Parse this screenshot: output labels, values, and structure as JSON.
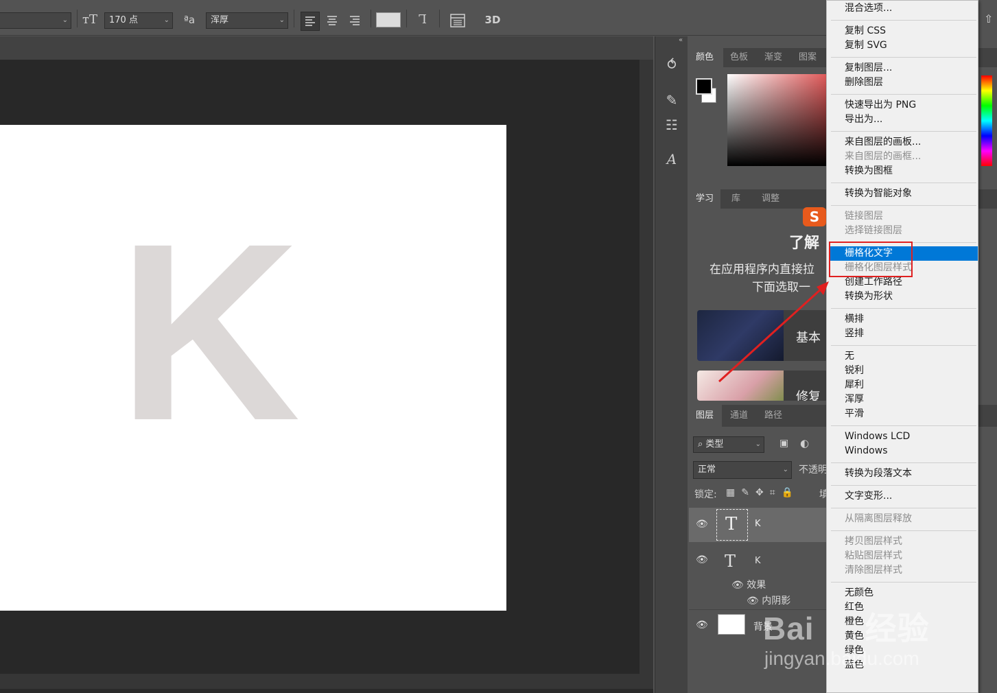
{
  "options_bar": {
    "font_size_value": "170 点",
    "aa_label": "a a",
    "antialias_value": "浑厚",
    "threed_label": "3D"
  },
  "panels": {
    "color_tabs": [
      "颜色",
      "色板",
      "渐变",
      "图案"
    ],
    "learn_tabs": [
      "学习",
      "库",
      "调整"
    ],
    "learn_title": "了解",
    "learn_desc_line1": "在应用程序内直接拉",
    "learn_desc_line2": "下面选取一",
    "learn_cards": [
      "基本",
      "修复"
    ],
    "layers_tabs": [
      "图层",
      "通道",
      "路径"
    ],
    "filter_kind": "类型",
    "blend_mode": "正常",
    "opacity_label": "不透明",
    "lock_label": "锁定:",
    "fill_label": "填"
  },
  "layers": [
    {
      "name": "K",
      "selected": true
    },
    {
      "name": "K",
      "selected": false,
      "effects_label": "效果",
      "effect_name": "内阴影"
    },
    {
      "name": "背景",
      "selected": false
    }
  ],
  "canvas": {
    "letter": "K",
    "letter_color": "#dcd8d7"
  },
  "context_menu": {
    "groups": [
      [
        {
          "label": "混合选项...",
          "disabled": false
        }
      ],
      [
        {
          "label": "复制 CSS",
          "disabled": false
        },
        {
          "label": "复制 SVG",
          "disabled": false
        }
      ],
      [
        {
          "label": "复制图层...",
          "disabled": false
        },
        {
          "label": "删除图层",
          "disabled": false
        }
      ],
      [
        {
          "label": "快速导出为 PNG",
          "disabled": false
        },
        {
          "label": "导出为...",
          "disabled": false
        }
      ],
      [
        {
          "label": "来自图层的画板...",
          "disabled": false
        },
        {
          "label": "来自图层的画框...",
          "disabled": true
        },
        {
          "label": "转换为图框",
          "disabled": false
        }
      ],
      [
        {
          "label": "转换为智能对象",
          "disabled": false
        }
      ],
      [
        {
          "label": "链接图层",
          "disabled": true
        },
        {
          "label": "选择链接图层",
          "disabled": true
        }
      ],
      [
        {
          "label": "栅格化文字",
          "disabled": false,
          "selected": true
        },
        {
          "label": "栅格化图层样式",
          "disabled": true
        },
        {
          "label": "创建工作路径",
          "disabled": false
        },
        {
          "label": "转换为形状",
          "disabled": false
        }
      ],
      [
        {
          "label": "横排",
          "disabled": false
        },
        {
          "label": "竖排",
          "disabled": false
        }
      ],
      [
        {
          "label": "无",
          "disabled": false
        },
        {
          "label": "锐利",
          "disabled": false
        },
        {
          "label": "犀利",
          "disabled": false
        },
        {
          "label": "浑厚",
          "disabled": false
        },
        {
          "label": "平滑",
          "disabled": false
        }
      ],
      [
        {
          "label": "Windows LCD",
          "disabled": false
        },
        {
          "label": "Windows",
          "disabled": false
        }
      ],
      [
        {
          "label": "转换为段落文本",
          "disabled": false
        }
      ],
      [
        {
          "label": "文字变形...",
          "disabled": false
        }
      ],
      [
        {
          "label": "从隔离图层释放",
          "disabled": true
        }
      ],
      [
        {
          "label": "拷贝图层样式",
          "disabled": true
        },
        {
          "label": "粘贴图层样式",
          "disabled": true
        },
        {
          "label": "清除图层样式",
          "disabled": true
        }
      ],
      [
        {
          "label": "无颜色",
          "disabled": false
        },
        {
          "label": "红色",
          "disabled": false
        },
        {
          "label": "橙色",
          "disabled": false
        },
        {
          "label": "黄色",
          "disabled": false
        },
        {
          "label": "绿色",
          "disabled": false
        },
        {
          "label": "蓝色",
          "disabled": false
        }
      ]
    ]
  },
  "annotation": {
    "highlight_color": "#e02020"
  },
  "watermark": {
    "brand": "Bai",
    "brand2": "经验",
    "domain": "jingyan.baidu.com"
  }
}
